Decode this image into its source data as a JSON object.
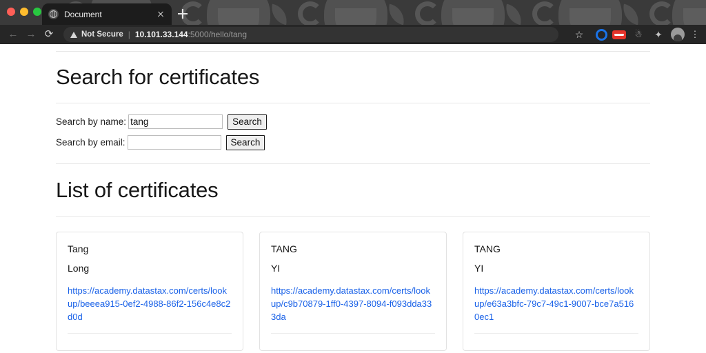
{
  "window": {
    "traffic_lights": [
      {
        "name": "close",
        "color": "#ff5f57"
      },
      {
        "name": "minimize",
        "color": "#febc2e"
      },
      {
        "name": "zoom",
        "color": "#28c840"
      }
    ]
  },
  "browser": {
    "tab": {
      "title": "Document",
      "favicon": "globe-icon",
      "close": "close-icon"
    },
    "new_tab_label": "+",
    "nav": {
      "back": "←",
      "forward": "→",
      "reload": "⟳"
    },
    "omnibox": {
      "security_label": "Not Secure",
      "separator": "|",
      "url_host": "10.101.33.144",
      "url_rest": ":5000/hello/tang"
    },
    "toolbar_icons": [
      {
        "name": "bookmark-star-icon",
        "glyph": "☆"
      },
      {
        "name": "sync-circle-icon",
        "glyph": ""
      },
      {
        "name": "password-manager-icon",
        "glyph": ""
      },
      {
        "name": "bug-report-icon",
        "glyph": "☃"
      },
      {
        "name": "extensions-puzzle-icon",
        "glyph": "✦"
      },
      {
        "name": "profile-avatar-icon",
        "glyph": ""
      },
      {
        "name": "chrome-menu-icon",
        "glyph": "⋮"
      }
    ]
  },
  "page": {
    "search_section": {
      "heading": "Search for certificates",
      "rows": [
        {
          "label": "Search by name:",
          "value": "tang",
          "placeholder": "",
          "button": "Search"
        },
        {
          "label": "Search by email:",
          "value": "",
          "placeholder": "",
          "button": "Search"
        }
      ]
    },
    "list_section": {
      "heading": "List of certificates",
      "cards": [
        {
          "first_name": "Tang",
          "last_name": "Long",
          "link": "https://academy.datastax.com/certs/lookup/beeea915-0ef2-4988-86f2-156c4e8c2d0d"
        },
        {
          "first_name": "TANG",
          "last_name": "YI",
          "link": "https://academy.datastax.com/certs/lookup/c9b70879-1ff0-4397-8094-f093dda333da"
        },
        {
          "first_name": "TANG",
          "last_name": "YI",
          "link": "https://academy.datastax.com/certs/lookup/e63a3bfc-79c7-49c1-9007-bce7a5160ec1"
        }
      ]
    }
  },
  "colors": {
    "link": "#1a62e8",
    "card_border": "#e2e2e2",
    "rule": "#e7e7e7",
    "chrome_toolbar": "#262626"
  }
}
